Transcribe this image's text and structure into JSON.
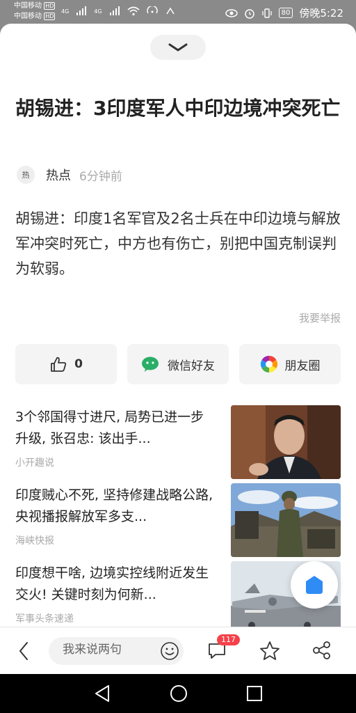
{
  "status_bar": {
    "carrier1": "中国移动",
    "carrier2": "中国移动",
    "hd_badge": "HD",
    "network": "4G",
    "battery": "80",
    "time": "傍晚5:22"
  },
  "article": {
    "title": "胡锡进：3印度军人中印边境冲突死亡",
    "source_avatar_text": "热",
    "source_name": "热点",
    "time": "6分钟前",
    "body": "胡锡进：印度1名军官及2名士兵在中印边境与解放军冲突时死亡，中方也有伤亡，别把中国克制误判为软弱。",
    "report_link": "我要举报"
  },
  "actions": {
    "like_count": "0",
    "wechat_label": "微信好友",
    "moments_label": "朋友圈"
  },
  "related_news": [
    {
      "title": "3个邻国得寸进尺, 局势已进一步升级, 张召忠: 该出手...",
      "source": "小开趣说"
    },
    {
      "title": "印度贼心不死, 坚持修建战略公路, 央视播报解放军多支...",
      "source": "海峡快报"
    },
    {
      "title": "印度想干啥, 边境实控线附近发生交火! 关键时刻为何新...",
      "source": "军事头条速递"
    }
  ],
  "bottom_bar": {
    "comment_placeholder": "我来说两句",
    "comment_count": "117"
  },
  "colors": {
    "accent_blue": "#2f8cf4",
    "badge_red": "#f4424a",
    "wechat_green": "#2aae67"
  }
}
